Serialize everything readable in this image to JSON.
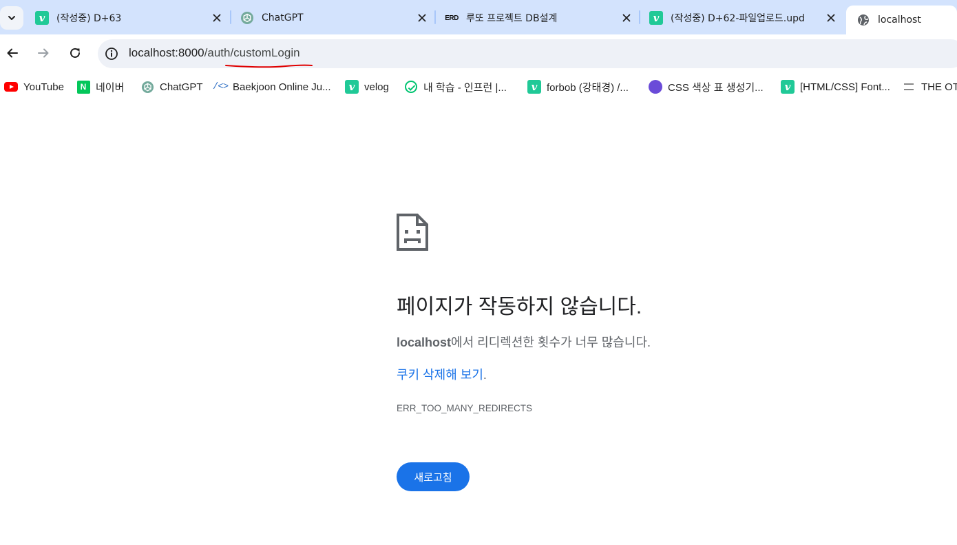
{
  "tabs": [
    {
      "title": "(작성중) D+63",
      "icon": "velog-icon"
    },
    {
      "title": "ChatGPT",
      "icon": "chatgpt-icon"
    },
    {
      "title": "루또 프로젝트 DB설계",
      "icon": "erd-icon",
      "icon_text": "ERD"
    },
    {
      "title": "(작성중) D+62-파일업로드.upd",
      "icon": "velog-icon"
    },
    {
      "title": "localhost",
      "icon": "globe-icon",
      "active": true
    }
  ],
  "toolbar": {
    "url_host": "localhost:8000",
    "url_path": "/auth/customLogin"
  },
  "bookmarks": [
    {
      "label": "YouTube",
      "icon": "youtube-icon"
    },
    {
      "label": "네이버",
      "icon": "naver-icon",
      "icon_text": "N"
    },
    {
      "label": "ChatGPT",
      "icon": "chatgpt-icon"
    },
    {
      "label": "Baekjoon Online Ju...",
      "icon": "code-icon",
      "icon_text": "/<>"
    },
    {
      "label": "velog",
      "icon": "velog-icon"
    },
    {
      "label": "내 학습 - 인프런 |...",
      "icon": "inflearn-icon"
    },
    {
      "label": "forbob (강태경) /...",
      "icon": "velog-icon"
    },
    {
      "label": "CSS 색상 표 생성기...",
      "icon": "css-icon"
    },
    {
      "label": "[HTML/CSS] Font...",
      "icon": "velog-icon"
    },
    {
      "label": "THE OTH",
      "icon": "bookmark-icon"
    }
  ],
  "error": {
    "heading": "페이지가 작동하지 않습니다.",
    "summary_host": "localhost",
    "summary_rest": "에서 리디렉션한 횟수가 너무 많습니다.",
    "suggestion_link": "쿠키 삭제해 보기",
    "suggestion_end": ".",
    "code": "ERR_TOO_MANY_REDIRECTS",
    "reload_label": "새로고침"
  },
  "colors": {
    "tabstrip_bg": "#d3e3fd",
    "link": "#1a73e8",
    "button": "#1a73e8",
    "annotation_underline": "#e00000"
  }
}
